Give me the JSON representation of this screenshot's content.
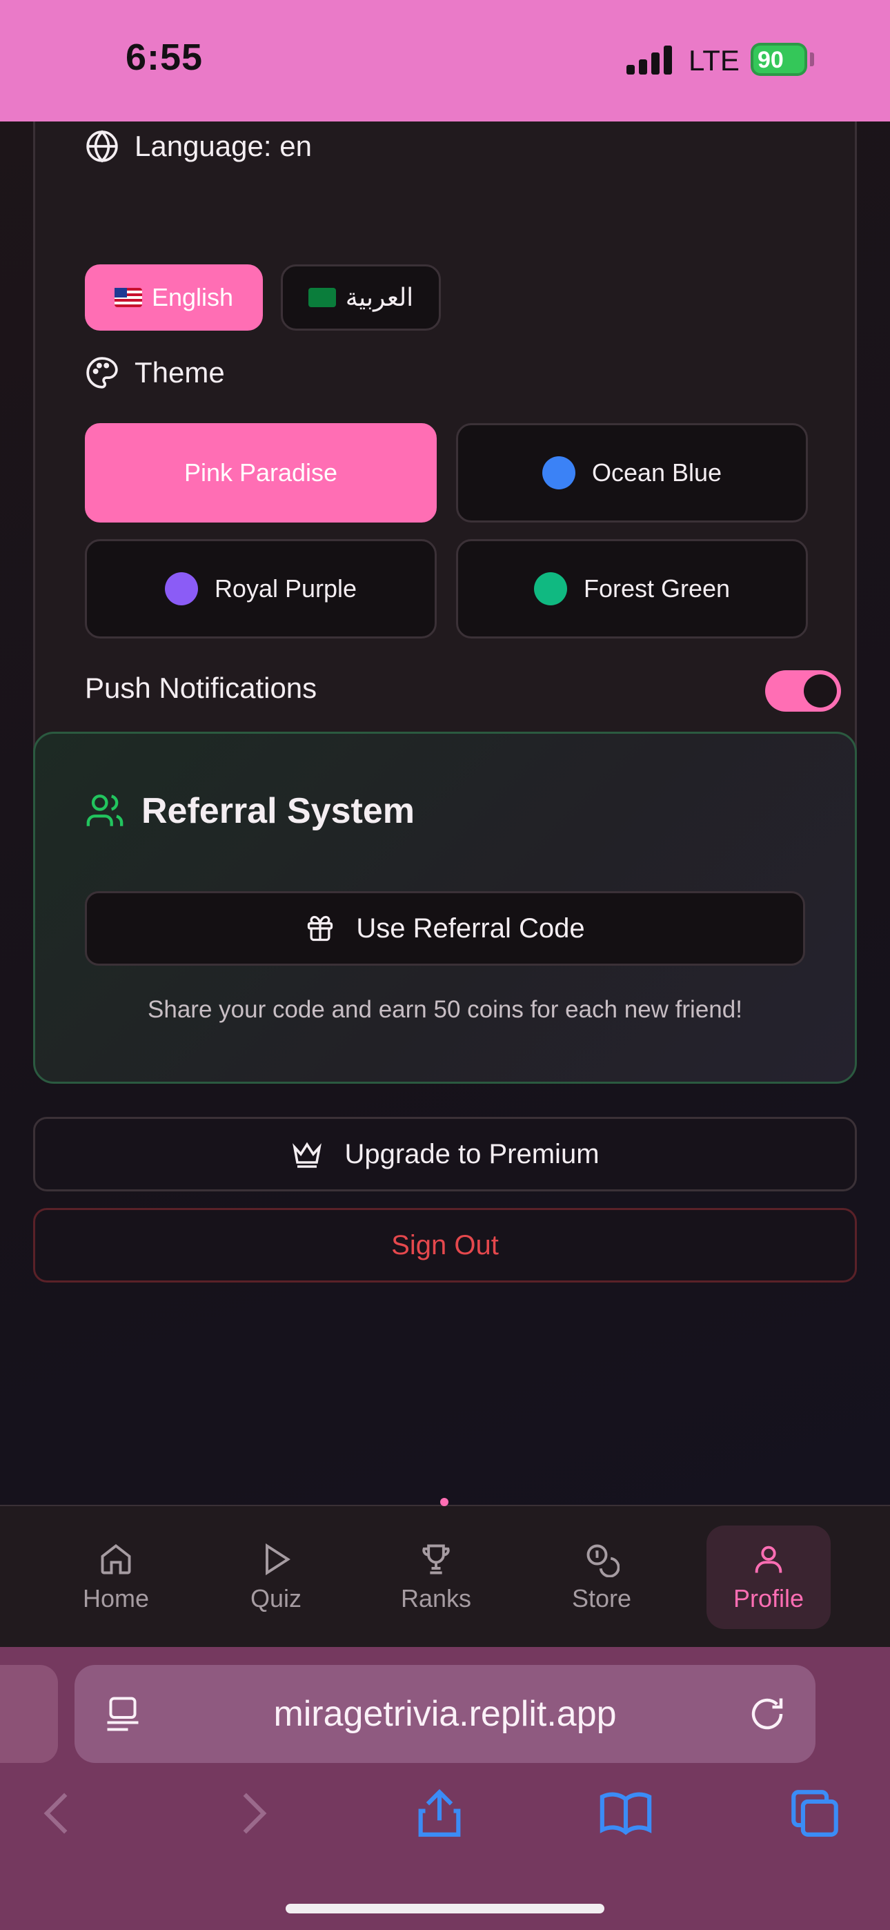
{
  "status_bar": {
    "time": "6:55",
    "carrier": "LTE",
    "battery": "90"
  },
  "settings": {
    "language_label": "Language: en",
    "languages": [
      {
        "label": "English",
        "flag_icon": "us-flag-icon",
        "selected": true
      },
      {
        "label": "العربية",
        "flag_icon": "saudi-flag-icon",
        "selected": false
      }
    ],
    "theme_label": "Theme",
    "themes": [
      {
        "label": "Pink Paradise",
        "color": "#ff6eb4",
        "selected": true
      },
      {
        "label": "Ocean Blue",
        "color": "#3b82f6",
        "selected": false
      },
      {
        "label": "Royal Purple",
        "color": "#8b5cf6",
        "selected": false
      },
      {
        "label": "Forest Green",
        "color": "#10b981",
        "selected": false
      }
    ],
    "push_label": "Push Notifications",
    "push_enabled": true
  },
  "referral": {
    "title": "Referral System",
    "button": "Use Referral Code",
    "hint": "Share your code and earn 50 coins for each new friend!"
  },
  "actions": {
    "upgrade": "Upgrade to Premium",
    "sign_out": "Sign Out"
  },
  "nav": {
    "items": [
      {
        "label": "Home",
        "icon": "home-icon"
      },
      {
        "label": "Quiz",
        "icon": "play-icon"
      },
      {
        "label": "Ranks",
        "icon": "trophy-icon"
      },
      {
        "label": "Store",
        "icon": "coins-icon"
      },
      {
        "label": "Profile",
        "icon": "user-icon",
        "active": true
      }
    ]
  },
  "browser": {
    "url": "miragetrivia.replit.app"
  },
  "colors": {
    "accent": "#ff6eb4",
    "danger": "#e5484d",
    "referral_green": "#22c55e"
  }
}
